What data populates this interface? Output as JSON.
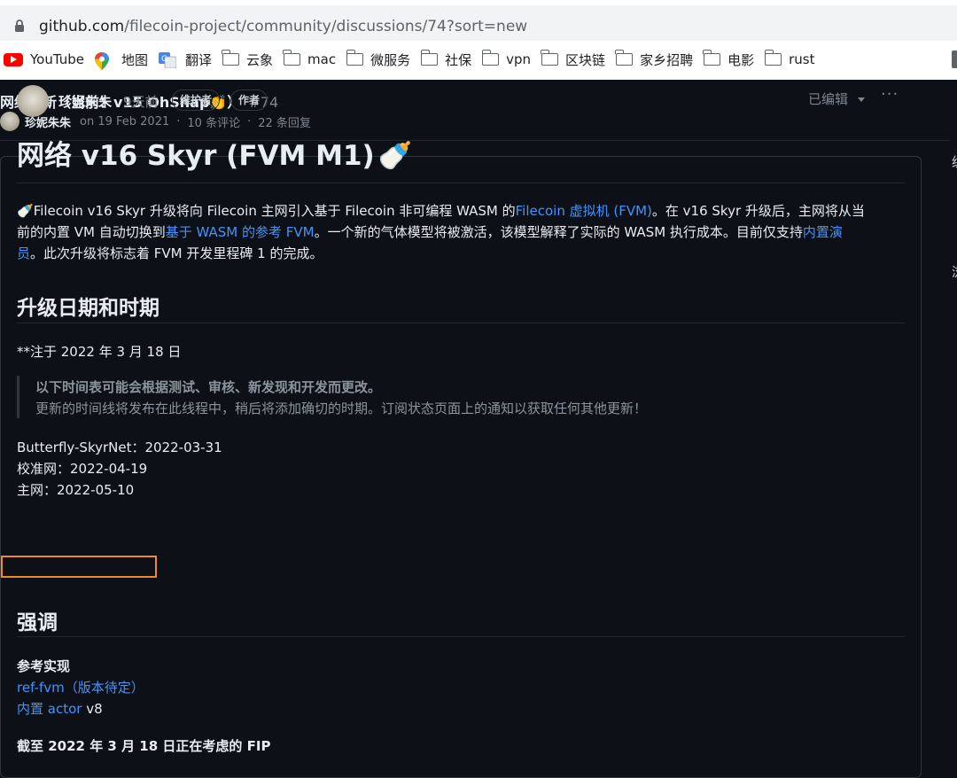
{
  "browser": {
    "url_domain": "github.com",
    "url_path": "/filecoin-project/community/discussions/74?sort=new",
    "bookmarks": [
      {
        "label": "YouTube",
        "icon": "youtube-icon"
      },
      {
        "label": "地图",
        "icon": "maps-icon"
      },
      {
        "label": "翻译",
        "icon": "translate-icon"
      },
      {
        "label": "云象",
        "icon": "folder-icon"
      },
      {
        "label": "mac",
        "icon": "folder-icon"
      },
      {
        "label": "微服务",
        "icon": "folder-icon"
      },
      {
        "label": "社保",
        "icon": "folder-icon"
      },
      {
        "label": "vpn",
        "icon": "folder-icon"
      },
      {
        "label": "区块链",
        "icon": "folder-icon"
      },
      {
        "label": "家乡招聘",
        "icon": "folder-icon"
      },
      {
        "label": "电影",
        "icon": "folder-icon"
      },
      {
        "label": "rust",
        "icon": "folder-icon"
      }
    ]
  },
  "discussion": {
    "title": "网络更新（当前：v15 OhSnap👏）",
    "number": "#74",
    "author": "珍妮朱朱",
    "date": "on 19 Feb 2021",
    "comments": "10 条评论",
    "replies": "22 条回复"
  },
  "post": {
    "author": "珍妮朱朱",
    "time": "9天前",
    "badge_maintainer": "维护者",
    "badge_author": "作者",
    "edited": "已编辑",
    "more": "···",
    "heading": "网络 v16 Skyr (FVM M1)",
    "heading_emoji": "🍼",
    "intro": {
      "emoji": "🍼",
      "t1": "Filecoin v16 Skyr 升级将向 Filecoin 主网引入基于 Filecoin 非可编程 WASM 的",
      "link1": "Filecoin 虚拟机 (FVM)",
      "t2": "。在 v16 Skyr 升级后，主网将从当",
      "t3": "前的内置 VM 自动切换到",
      "link2": "基于 WASM 的参考 FVM",
      "t4": "。一个新的气体模型将被激活，该模型解释了实际的 WASM 执行成本。目前仅支持",
      "link3a": "内置演",
      "link3b": "员",
      "t5": "。此次升级将标志着 FVM 开发里程碑 1 的完成。"
    },
    "section1": "升级日期和时期",
    "note": "**注于 2022 年 3 月 18 日",
    "quote1": "以下时间表可能会根据测试、审核、新发现和开发而更改。",
    "quote2": "更新的时间线将发布在此线程中，稍后将添加确切的时期。订阅状态页面上的通知以获取任何其他更新！",
    "schedule": [
      "Butterfly-SkyrNet：2022-03-31",
      "校准网：2022-04-19",
      "主网：2022-05-10"
    ],
    "section2": "强调",
    "ref_title": "参考实现",
    "ref1_link": "ref-fvm（版本待定）",
    "ref2_link": "内置 actor",
    "ref2_text": " v8",
    "fip_heading": "截至 2022 年 3 月 18 日正在考虑的 FIP"
  },
  "sidebar_fragments": [
    "级",
    "浏"
  ]
}
